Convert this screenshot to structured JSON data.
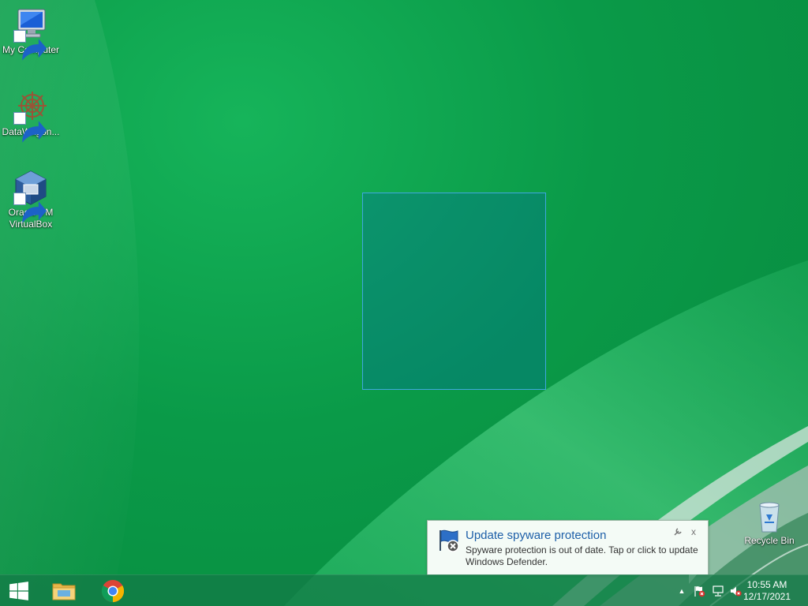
{
  "desktop": {
    "icons": [
      {
        "label": "My Computer",
        "icon": "computer-icon"
      },
      {
        "label": "DataWagon...",
        "icon": "datawagon-icon"
      },
      {
        "label": "Oracle VM\nVirtualBox",
        "icon": "virtualbox-icon"
      },
      {
        "label": "Recycle Bin",
        "icon": "recycle-bin-icon"
      }
    ],
    "wallpaper_colors": {
      "base": "#0a9a48",
      "highlight": "#5ad08a"
    }
  },
  "notification": {
    "title": "Update spyware protection",
    "body": "Spyware protection is out of date. Tap or click to update Windows Defender.",
    "icon": "action-center-flag-icon",
    "options_icon": "options-icon",
    "close_label": "x"
  },
  "taskbar": {
    "start_icon": "windows-logo-icon",
    "pinned": [
      {
        "name": "File Explorer",
        "icon": "folder-icon"
      },
      {
        "name": "Google Chrome",
        "icon": "chrome-icon"
      }
    ],
    "tray": {
      "show_hidden": "▲",
      "icons": [
        "action-center-error-icon",
        "network-icon",
        "volume-muted-icon"
      ],
      "time": "10:55 AM",
      "date": "12/17/2021"
    }
  }
}
